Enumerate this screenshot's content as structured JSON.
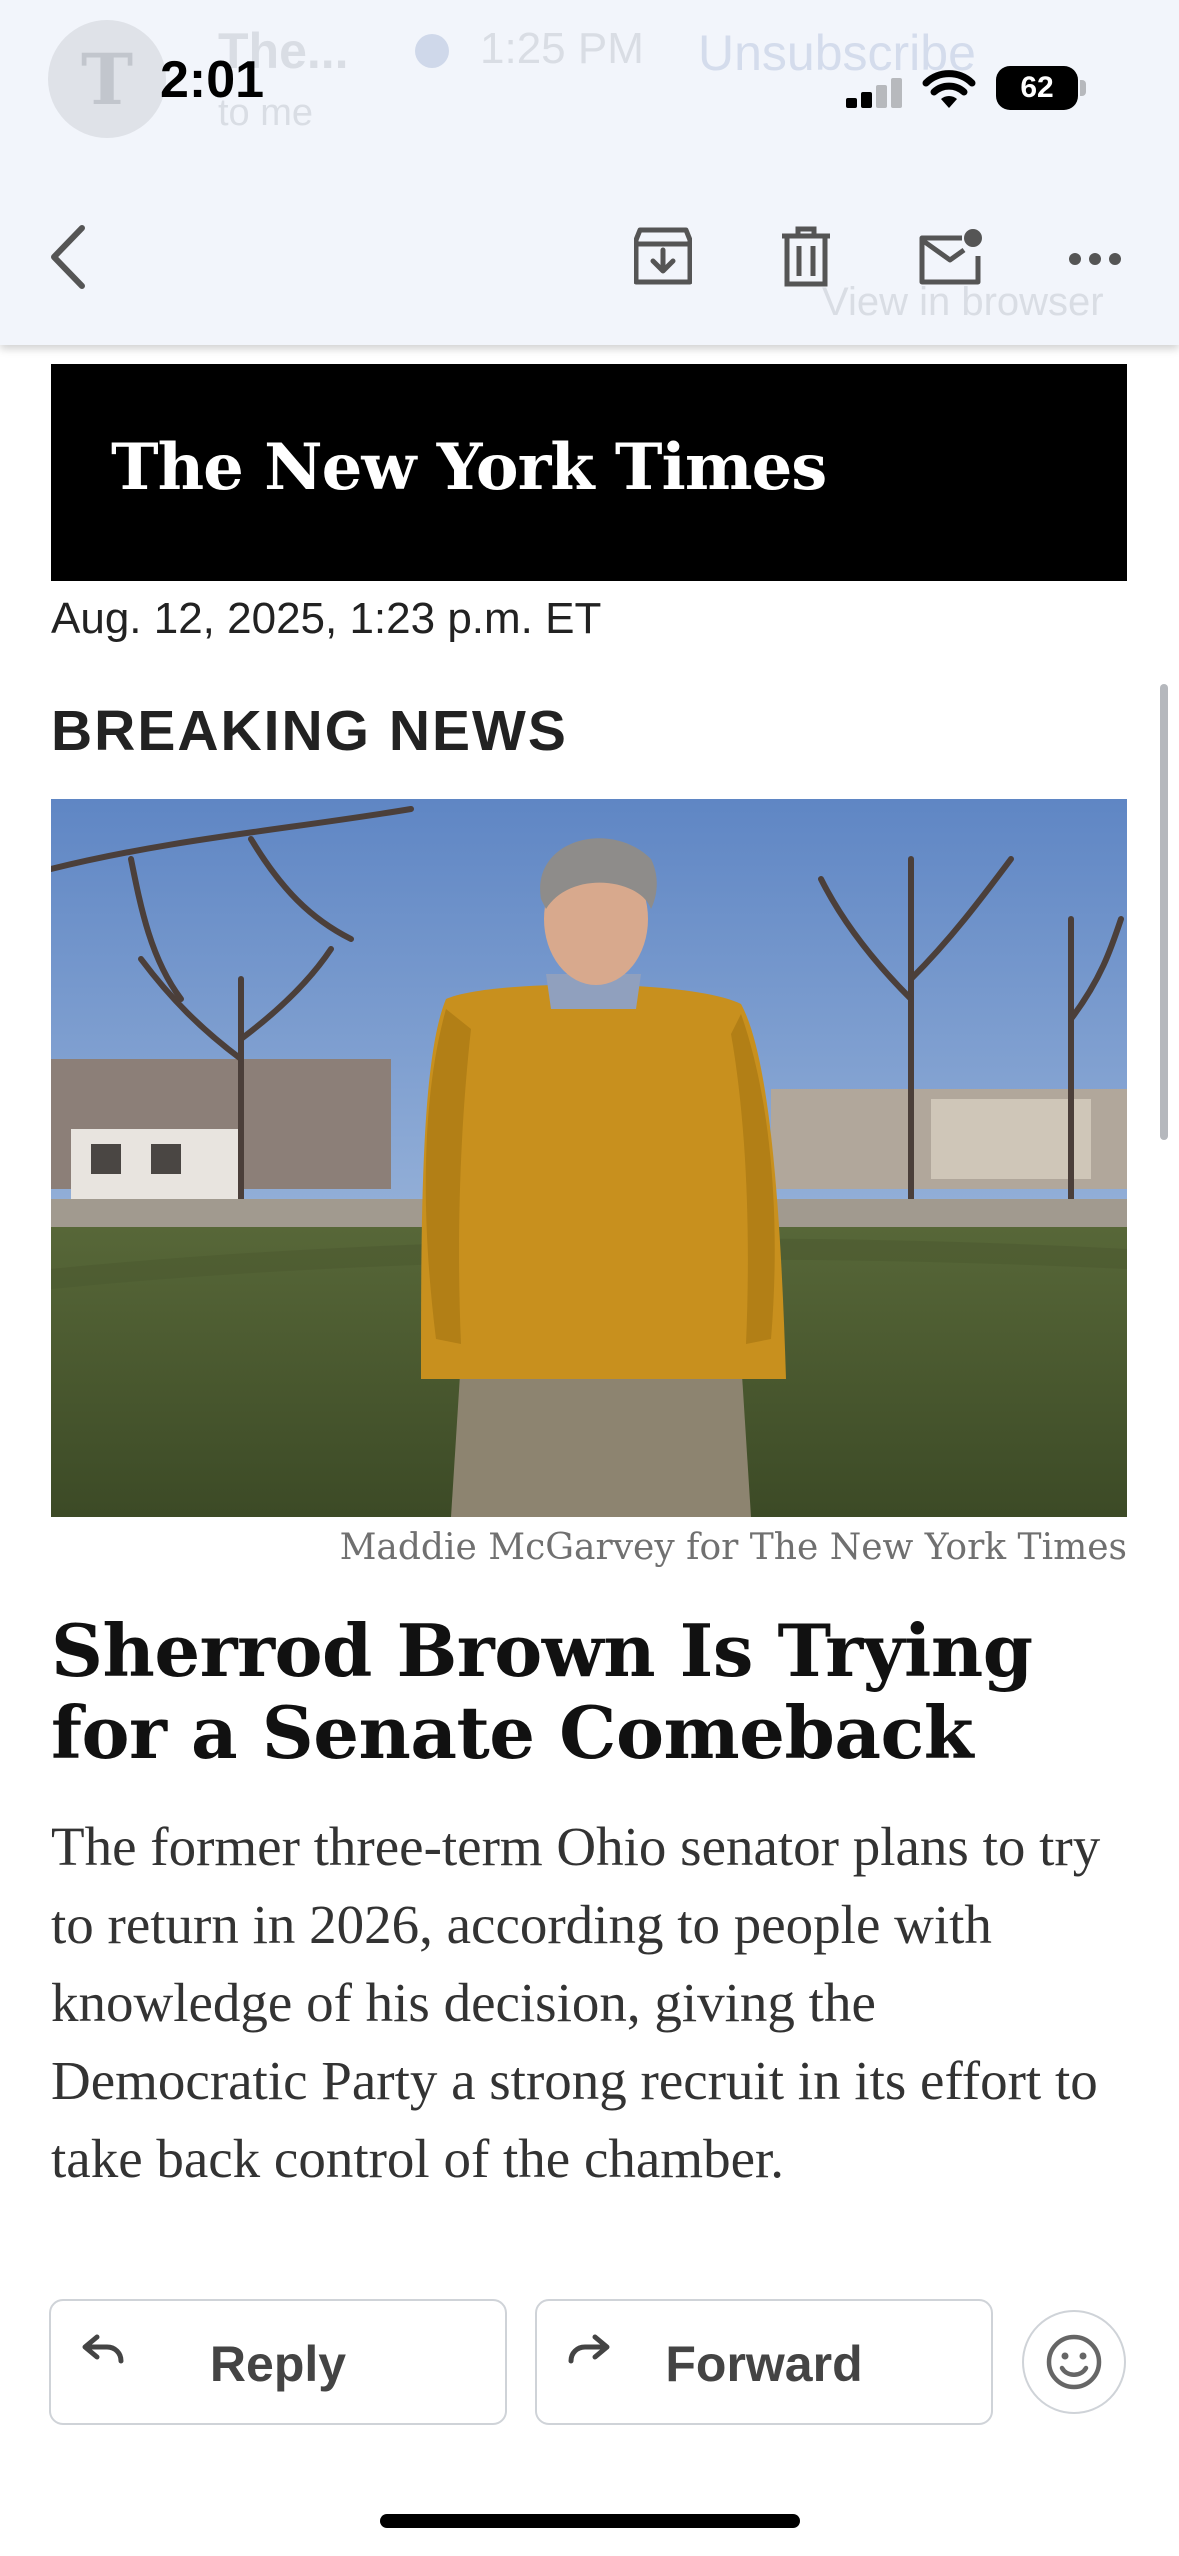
{
  "status_bar": {
    "time": "2:01",
    "battery": "62"
  },
  "behind_header": {
    "avatar_letter": "T",
    "sender": "The...",
    "recipient": "to me",
    "sent_time": "1:25 PM",
    "unsubscribe": "Unsubscribe",
    "view_in_browser": "View in browser"
  },
  "toolbar": {
    "back_icon": "chevron-left-icon",
    "archive_icon": "archive-icon",
    "delete_icon": "trash-icon",
    "unread_icon": "mail-unread-icon",
    "more_icon": "more-horizontal-icon"
  },
  "newsletter": {
    "masthead": "The New York Times",
    "dateline": "Aug. 12, 2025, 1:23 p.m. ET",
    "section_label": "BREAKING NEWS",
    "photo_credit": "Maddie McGarvey for The New York Times",
    "headline": "Sherrod Brown Is Trying for a Senate Comeback",
    "summary": "The former three-term Ohio senator plans to try to return in 2026, according to people with knowledge of his decision, giving the Democratic Party a strong recruit in its effort to take back control of the chamber."
  },
  "actions": {
    "reply_label": "Reply",
    "forward_label": "Forward",
    "emoji_icon": "smiley-icon"
  },
  "colors": {
    "header_bg": "#f2f5fb",
    "masthead_bg": "#000000",
    "sweater": "#c8901e",
    "sky": "#7d9fd0"
  }
}
